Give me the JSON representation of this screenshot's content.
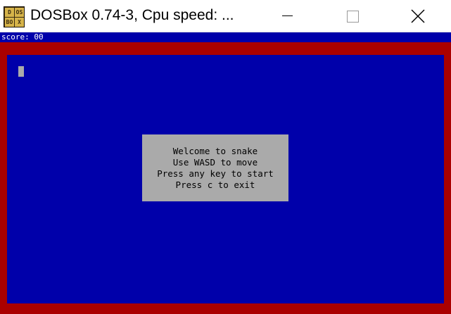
{
  "window": {
    "title": "DOSBox 0.74-3, Cpu speed:   ...",
    "icon": "dosbox-icon",
    "icon_letters": [
      "DOS",
      "",
      "BOX",
      ""
    ],
    "controls": [
      "minimize-icon",
      "maximize-icon",
      "close-icon"
    ]
  },
  "game": {
    "score_label": "score: 00",
    "dialog_lines": [
      "Welcome to snake",
      "Use WASD to move",
      "Press any key to start",
      "Press c to exit"
    ]
  },
  "colors": {
    "border": "#aa0000",
    "playfield": "#0000aa",
    "dialog": "#aaaaaa",
    "snake": "#aaaaaa",
    "text_light": "#ffffff",
    "text_dark": "#000000"
  }
}
